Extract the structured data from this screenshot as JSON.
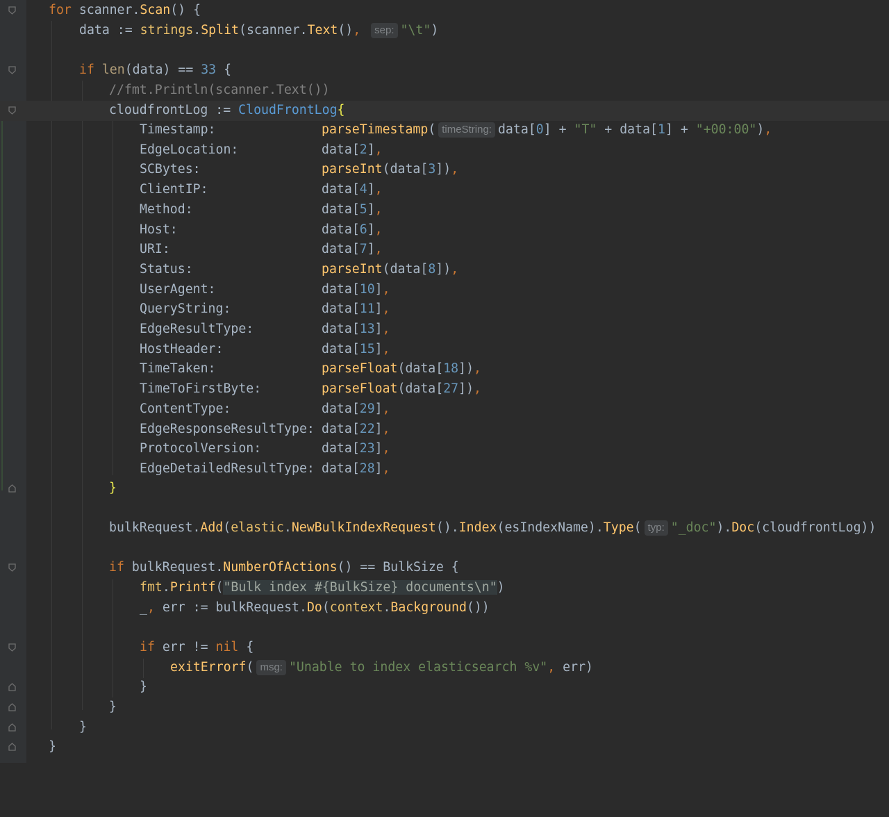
{
  "editor": {
    "theme_colors": {
      "background": "#2b2b2b",
      "keyword": "#cc7832",
      "function": "#ffc66d",
      "string": "#6a8759",
      "number": "#6897bb",
      "type": "#5a9bd5",
      "comment": "#808080"
    },
    "hints": {
      "sep": "sep:",
      "time_string": "timeString:",
      "typ": "typ:",
      "msg": "msg:"
    },
    "code": {
      "for_kw": "for",
      "scanner": "scanner",
      "scan": "Scan",
      "data": "data",
      "strings": "strings",
      "split": "Split",
      "text": "Text",
      "tab_str": "\"\\t\"",
      "if_kw": "if",
      "len": "len",
      "num_33": "33",
      "comment": "//fmt.Println(scanner.Text())",
      "cloudfront_log_var": "cloudfrontLog",
      "cloudfront_log_type": "CloudFrontLog",
      "parse_timestamp": "parseTimestamp",
      "t_str": "\"T\"",
      "tz_str": "\"+00:00\"",
      "bulk_request": "bulkRequest",
      "add": "Add",
      "elastic": "elastic",
      "new_bulk": "NewBulkIndexRequest",
      "index": "Index",
      "es_index_name": "esIndexName",
      "type_fn": "Type",
      "doc_str": "\"_doc\"",
      "doc_fn": "Doc",
      "number_of_actions": "NumberOfActions",
      "bulk_size": "BulkSize",
      "fmt": "fmt",
      "printf": "Printf",
      "printf_str": "\"Bulk index #{BulkSize} documents\\n\"",
      "underscore": "_",
      "err": "err",
      "do_fn": "Do",
      "context": "context",
      "background": "Background",
      "nil": "nil",
      "exit_errorf": "exitErrorf",
      "error_str": "\"Unable to index elasticsearch %v\""
    },
    "fields": [
      {
        "name": "Timestamp:",
        "func": "",
        "index": ""
      },
      {
        "name": "EdgeLocation:",
        "func": "",
        "index": "2"
      },
      {
        "name": "SCBytes:",
        "func": "parseInt",
        "index": "3"
      },
      {
        "name": "ClientIP:",
        "func": "",
        "index": "4"
      },
      {
        "name": "Method:",
        "func": "",
        "index": "5"
      },
      {
        "name": "Host:",
        "func": "",
        "index": "6"
      },
      {
        "name": "URI:",
        "func": "",
        "index": "7"
      },
      {
        "name": "Status:",
        "func": "parseInt",
        "index": "8"
      },
      {
        "name": "UserAgent:",
        "func": "",
        "index": "10"
      },
      {
        "name": "QueryString:",
        "func": "",
        "index": "11"
      },
      {
        "name": "EdgeResultType:",
        "func": "",
        "index": "13"
      },
      {
        "name": "HostHeader:",
        "func": "",
        "index": "15"
      },
      {
        "name": "TimeTaken:",
        "func": "parseFloat",
        "index": "18"
      },
      {
        "name": "TimeToFirstByte:",
        "func": "parseFloat",
        "index": "27"
      },
      {
        "name": "ContentType:",
        "func": "",
        "index": "29"
      },
      {
        "name": "EdgeResponseResultType:",
        "func": "",
        "index": "22"
      },
      {
        "name": "ProtocolVersion:",
        "func": "",
        "index": "23"
      },
      {
        "name": "EdgeDetailedResultType:",
        "func": "",
        "index": "28"
      }
    ],
    "ts_index_0": "0",
    "ts_index_1": "1"
  }
}
